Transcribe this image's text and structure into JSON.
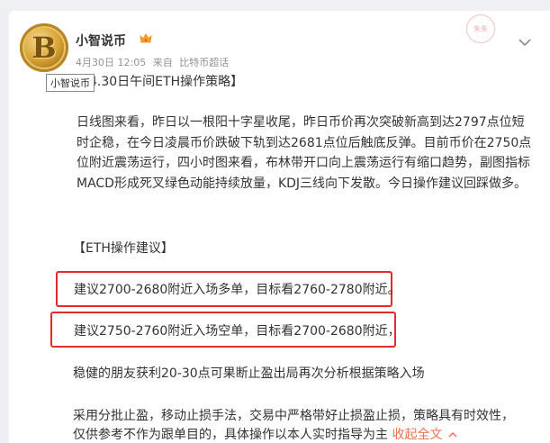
{
  "post": {
    "author": "小智说币",
    "date": "4月30日 12:05",
    "source_prefix": "来自",
    "source": "比特币超话",
    "avatar_letter": "B",
    "tooltip": "小智说币",
    "stamp_text": "朱朱"
  },
  "content": {
    "title": "【4.30日午间ETH操作策略】",
    "analysis": "日线图来看，昨日以一根阳十字星收尾，昨日币价再次突破新高到达2797点位短时企稳，在今日凌晨币价跌破下轨到达2681点位后触底反弹。目前币价在2750点位附近震荡运行，四小时图来看，布林带开口向上震荡运行有缩口趋势，副图指标MACD形成死叉绿色动能持续放量，KDJ三线向下发散。今日操作建议回踩做多。",
    "advice_title": "【ETH操作建议】",
    "advice_long": "建议2700-2680附近入场多单，目标看2760-2780附近。",
    "advice_short": "建议2750-2760附近入场空单，目标看2700-2680附近，",
    "stable_note": "稳健的朋友获利20-30点可果断止盈出局再次分析根据策略入场",
    "risk_line1": "采用分批止盈，移动止损手法，交易中严格带好止损盈止损，策略具有时效性，",
    "risk_line2": "仅供参考不作为跟单目的，具体操作以本人实时指导为主",
    "expand_label": "收起全文"
  },
  "colors": {
    "highlight_border": "#e42a2a",
    "link": "#eb7350"
  }
}
